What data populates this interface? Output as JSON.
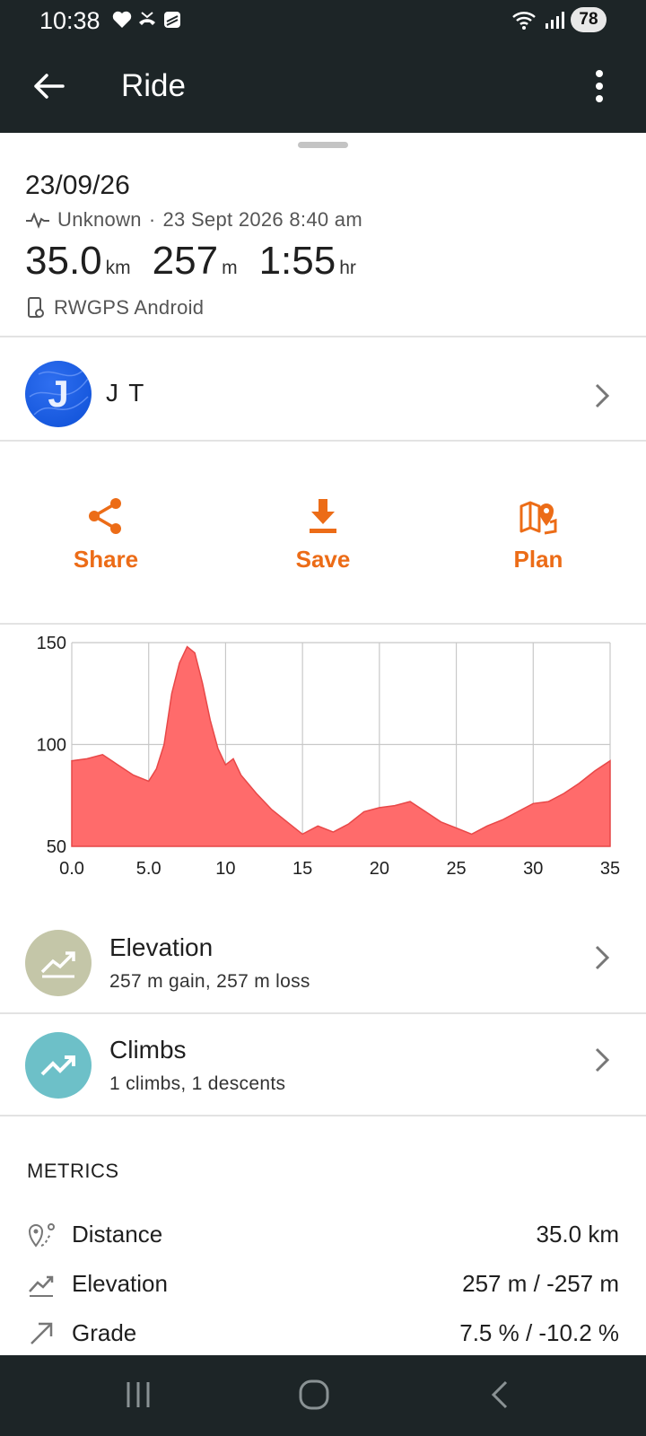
{
  "status_bar": {
    "time": "10:38",
    "signal_label": "5",
    "battery": "78"
  },
  "app_bar": {
    "title": "Ride"
  },
  "trip": {
    "date_title": "23/09/26",
    "activity": "Unknown",
    "separator": "·",
    "datetime": "23 Sept 2026 8:40 am",
    "stats": [
      {
        "value": "35.0",
        "unit": "km"
      },
      {
        "value": "257",
        "unit": "m"
      },
      {
        "value": "1:55",
        "unit": "hr"
      }
    ],
    "device": "RWGPS Android"
  },
  "user": {
    "initial": "J",
    "name": "J T"
  },
  "actions": {
    "share": "Share",
    "save": "Save",
    "plan": "Plan"
  },
  "chart_data": {
    "type": "area",
    "color": "#ff6b6b",
    "xlim": [
      0,
      35
    ],
    "ylim": [
      50,
      150
    ],
    "x_ticks": [
      "0.0",
      "5.0",
      "10",
      "15",
      "20",
      "25",
      "30",
      "35"
    ],
    "y_ticks": [
      "150",
      "100",
      "50"
    ],
    "x": [
      0,
      1,
      2,
      3,
      4,
      5,
      5.5,
      6,
      6.5,
      7,
      7.5,
      8,
      8.5,
      9,
      9.5,
      10,
      10.5,
      11,
      12,
      13,
      14,
      15,
      16,
      17,
      18,
      19,
      20,
      21,
      22,
      23,
      24,
      25,
      26,
      27,
      28,
      29,
      30,
      31,
      32,
      33,
      34,
      35
    ],
    "y": [
      92,
      93,
      95,
      90,
      85,
      82,
      88,
      100,
      125,
      140,
      148,
      145,
      130,
      112,
      98,
      90,
      93,
      85,
      76,
      68,
      62,
      56,
      60,
      57,
      61,
      67,
      69,
      70,
      72,
      67,
      62,
      59,
      56,
      60,
      63,
      67,
      71,
      72,
      76,
      81,
      87,
      92
    ]
  },
  "elevation_row": {
    "title": "Elevation",
    "summary": "257 m gain, 257 m loss"
  },
  "climbs_row": {
    "title": "Climbs",
    "summary": "1 climbs, 1 descents"
  },
  "metrics": {
    "heading": "METRICS",
    "items": [
      {
        "label": "Distance",
        "value": "35.0 km",
        "icon": "distance-icon"
      },
      {
        "label": "Elevation",
        "value": "257 m / -257 m",
        "icon": "elevation-icon"
      },
      {
        "label": "Grade",
        "value": "7.5 % / -10.2 %",
        "icon": "grade-icon"
      }
    ]
  }
}
